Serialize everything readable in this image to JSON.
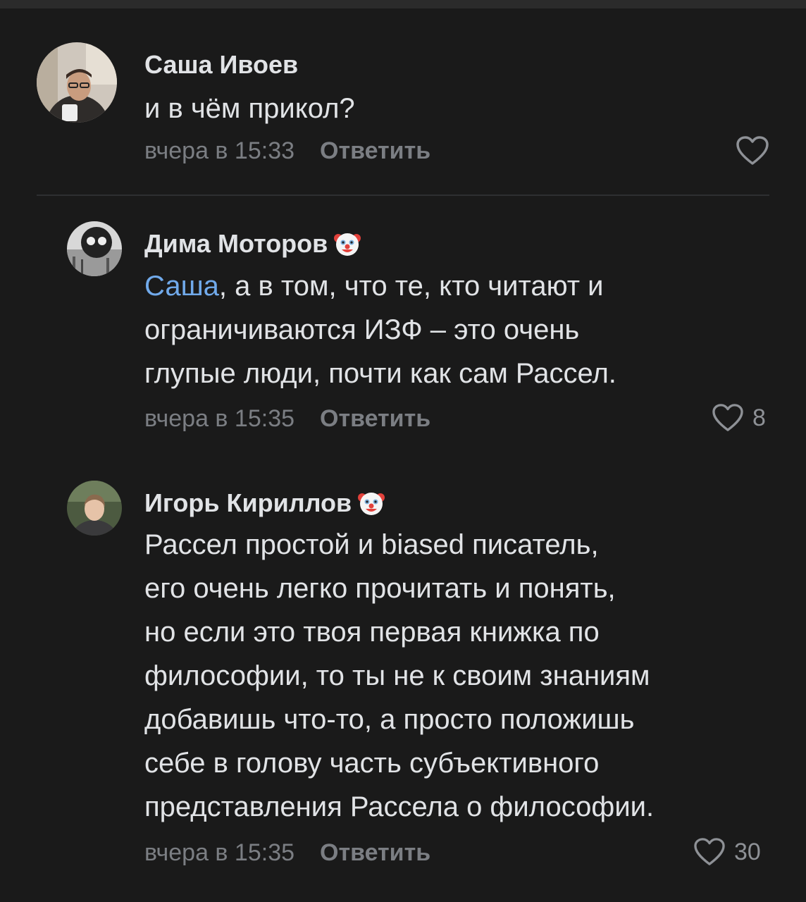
{
  "comments": [
    {
      "author": "Саша Ивоев",
      "has_clown": false,
      "mention": "",
      "text_lines": [
        "и в чём прикол?"
      ],
      "time": "вчера в 15:33",
      "reply_label": "Ответить",
      "likes": ""
    },
    {
      "author": "Дима Моторов",
      "has_clown": true,
      "mention": "Саша",
      "text_first_rest": ", а в том, что те, кто читают и",
      "text_lines": [
        "ограничиваются ИЗФ – это очень",
        "глупые люди, почти как сам Рассел."
      ],
      "time": "вчера в 15:35",
      "reply_label": "Ответить",
      "likes": "8"
    },
    {
      "author": "Игорь Кириллов",
      "has_clown": true,
      "mention": "",
      "text_lines": [
        "Рассел простой и biased писатель,",
        "его очень легко прочитать и понять,",
        "но если это твоя первая книжка по",
        "философии, то ты не к своим знаниям",
        "добавишь что-то, а просто положишь",
        "себе в голову часть субъективного",
        "представления Рассела о философии."
      ],
      "time": "вчера в 15:35",
      "reply_label": "Ответить",
      "likes": "30"
    }
  ],
  "colors": {
    "background": "#1a1a1a",
    "text": "#e1e3e6",
    "meta": "#7b7e83",
    "mention": "#71aaeb"
  },
  "icons": [
    "heart-outline-icon",
    "clown-emoji-icon"
  ]
}
